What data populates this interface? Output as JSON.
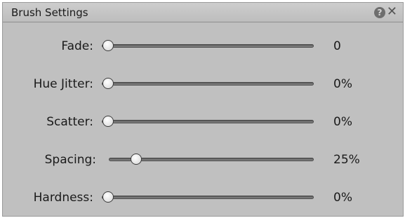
{
  "panel": {
    "title": "Brush Settings",
    "help_icon": "question-mark",
    "close_icon": "x"
  },
  "sliders": [
    {
      "label": "Fade:",
      "value": "0",
      "fraction": 0
    },
    {
      "label": "Hue Jitter:",
      "value": "0%",
      "fraction": 0
    },
    {
      "label": "Scatter:",
      "value": "0%",
      "fraction": 0
    },
    {
      "label": "Spacing:",
      "value": "25%",
      "fraction": 0.11
    },
    {
      "label": "Hardness:",
      "value": "0%",
      "fraction": 0
    }
  ]
}
